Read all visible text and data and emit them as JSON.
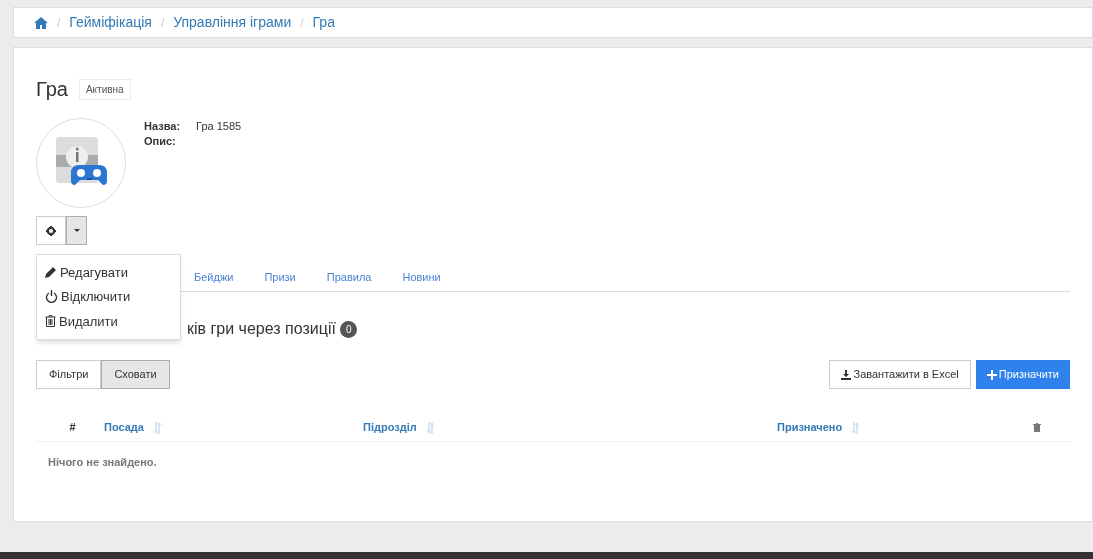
{
  "breadcrumb": [
    {
      "separator": "/",
      "label": "Гейміфікація"
    },
    {
      "separator": "/",
      "label": "Управління іграми"
    },
    {
      "separator": "/",
      "label": "Гра"
    }
  ],
  "page": {
    "title": "Гра",
    "status_badge": "Активна"
  },
  "details": [
    {
      "label": "Назва:",
      "value": "Гра 1585"
    },
    {
      "label": "Опис:"
    }
  ],
  "action_menu": {
    "expanded": true,
    "items": [
      {
        "kind": "edit",
        "label": "Редагувати"
      },
      {
        "kind": "power",
        "label": "Відключити"
      },
      {
        "kind": "delete",
        "label": "Видалити"
      }
    ]
  },
  "tabs": [
    {
      "label": "Бейджи"
    },
    {
      "label": "Призи"
    },
    {
      "label": "Правила"
    },
    {
      "label": "Новини"
    }
  ],
  "section": {
    "title": "ків гри через позиції",
    "count": "0"
  },
  "toolbar": {
    "toggles": [
      {
        "label": "Фільтри",
        "selected": false
      },
      {
        "label": "Сховати",
        "selected": true
      }
    ],
    "export_button": "Завантажити в Excel",
    "assign_button": "Призначити"
  },
  "table": {
    "columns": [
      {
        "kind": "index",
        "label": "#"
      },
      {
        "kind": "sortable",
        "label": "Посада"
      },
      {
        "kind": "sortable",
        "label": "Підрозділ"
      },
      {
        "kind": "sortable",
        "label": "Призначено"
      },
      {
        "kind": "delete"
      }
    ],
    "empty_message": "Нічого не знайдено."
  }
}
